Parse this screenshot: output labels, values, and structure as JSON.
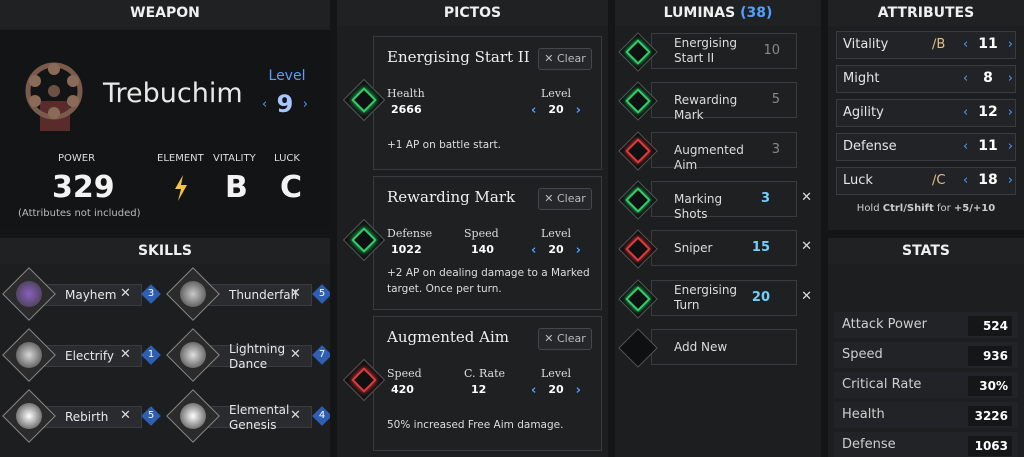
{
  "weapon": {
    "header": "WEAPON",
    "name": "Trebuchim",
    "level_label": "Level",
    "level": "9",
    "power_label": "POWER",
    "power": "329",
    "power_note": "(Attributes not included)",
    "element_label": "ELEMENT",
    "vitality_label": "VITALITY",
    "vitality": "B",
    "luck_label": "LUCK",
    "luck": "C"
  },
  "skills": {
    "header": "SKILLS",
    "items": [
      {
        "name": "Mayhem",
        "cost": "3"
      },
      {
        "name": "Thunderfall",
        "cost": "5"
      },
      {
        "name": "Electrify",
        "cost": "1"
      },
      {
        "name": "Lightning Dance",
        "cost": "7"
      },
      {
        "name": "Rebirth",
        "cost": "5"
      },
      {
        "name": "Elemental Genesis",
        "cost": "4"
      }
    ]
  },
  "pictos": {
    "header": "PICTOS",
    "clear_label": "Clear",
    "cards": [
      {
        "title": "Energising Start II",
        "stat1_label": "Health",
        "stat1": "2666",
        "stat2_label": "",
        "stat2": "",
        "level_label": "Level",
        "level": "20",
        "desc": "+1 AP on battle start.",
        "color": "#2fd06a"
      },
      {
        "title": "Rewarding Mark",
        "stat1_label": "Defense",
        "stat1": "1022",
        "stat2_label": "Speed",
        "stat2": "140",
        "level_label": "Level",
        "level": "20",
        "desc": "+2 AP on dealing damage to a Marked target. Once per turn.",
        "color": "#2fd06a"
      },
      {
        "title": "Augmented Aim",
        "stat1_label": "Speed",
        "stat1": "420",
        "stat2_label": "C. Rate",
        "stat2": "12",
        "level_label": "Level",
        "level": "20",
        "desc": "50% increased Free Aim damage.",
        "color": "#e03a3a"
      }
    ]
  },
  "luminas": {
    "header": "LUMINAS",
    "count": "(38)",
    "items": [
      {
        "name": "Energising Start II",
        "cost": "10",
        "color": "#2fd06a"
      },
      {
        "name": "Rewarding Mark",
        "cost": "5",
        "color": "#2fd06a"
      },
      {
        "name": "Augmented Aim",
        "cost": "3",
        "color": "#e03a3a"
      },
      {
        "name": "Marking Shots",
        "cost": "3",
        "color": "#2fd06a"
      },
      {
        "name": "Sniper",
        "cost": "15",
        "color": "#e03a3a"
      },
      {
        "name": "Energising Turn",
        "cost": "20",
        "color": "#2fd06a"
      }
    ],
    "add_label": "Add New"
  },
  "attributes": {
    "header": "ATTRIBUTES",
    "items": [
      {
        "name": "Vitality",
        "grade": "B",
        "value": "11"
      },
      {
        "name": "Might",
        "grade": "",
        "value": "8"
      },
      {
        "name": "Agility",
        "grade": "",
        "value": "12"
      },
      {
        "name": "Defense",
        "grade": "",
        "value": "11"
      },
      {
        "name": "Luck",
        "grade": "C",
        "value": "18"
      }
    ],
    "hold_prefix": "Hold",
    "hold_keys": "Ctrl/Shift",
    "hold_for": "for",
    "hold_amount": "+5/+10"
  },
  "stats": {
    "header": "STATS",
    "items": [
      {
        "name": "Attack Power",
        "value": "524"
      },
      {
        "name": "Speed",
        "value": "936"
      },
      {
        "name": "Critical Rate",
        "value": "30%"
      },
      {
        "name": "Health",
        "value": "3226"
      },
      {
        "name": "Defense",
        "value": "1063"
      }
    ]
  },
  "icons": {
    "element": "lightning-icon",
    "clear": "x-icon",
    "remove": "x-icon",
    "increase": "chevron-right-icon",
    "decrease": "chevron-left-icon"
  }
}
